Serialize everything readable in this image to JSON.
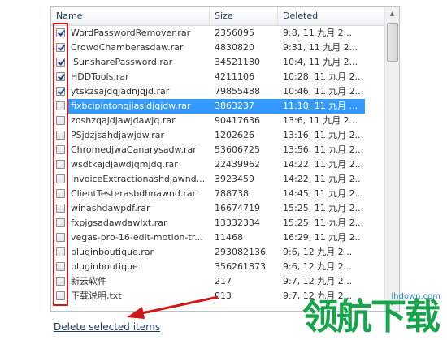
{
  "columns": {
    "name": "Name",
    "size": "Size",
    "deleted": "Deleted"
  },
  "rows": [
    {
      "name": "WordPasswordRemover.rar",
      "size": "2356095",
      "deleted": "9:8, 11 九月 2...",
      "checked": true,
      "selected": false
    },
    {
      "name": "CrowdChamberasdaw.rar",
      "size": "4830820",
      "deleted": "9:31, 11 九月 2...",
      "checked": true,
      "selected": false
    },
    {
      "name": "iSunsharePassword.rar",
      "size": "34521180",
      "deleted": "10:4, 11 九月 2...",
      "checked": true,
      "selected": false
    },
    {
      "name": "HDDTools.rar",
      "size": "4211106",
      "deleted": "10:28, 11 九月 2...",
      "checked": true,
      "selected": false
    },
    {
      "name": "ytskzsajdqjadnjqjd.rar",
      "size": "79855488",
      "deleted": "10:46, 11 九月 2...",
      "checked": true,
      "selected": false
    },
    {
      "name": "fixbcipintongjiasjdjqjdw.rar",
      "size": "3863237",
      "deleted": "11:18, 11 九月 ...",
      "checked": false,
      "selected": true
    },
    {
      "name": "zoshzqajdjawjdawjq.rar",
      "size": "90417636",
      "deleted": "13:6, 11 九月 2...",
      "checked": false,
      "selected": false
    },
    {
      "name": "PSjdzjsahdjawjdw.rar",
      "size": "1202626",
      "deleted": "13:16, 11 九月 2...",
      "checked": false,
      "selected": false
    },
    {
      "name": "ChromedjwaCanarysadw.rar",
      "size": "53606725",
      "deleted": "13:56, 11 九月 2...",
      "checked": false,
      "selected": false
    },
    {
      "name": "wsdtkajdjawdjqmjdq.rar",
      "size": "22439962",
      "deleted": "14:22, 11 九月 2...",
      "checked": false,
      "selected": false
    },
    {
      "name": "InvoiceExtractionashdjawnd...",
      "size": "3923459",
      "deleted": "14:22, 11 九月 2...",
      "checked": false,
      "selected": false
    },
    {
      "name": "ClientTesterasbdhnawnd.rar",
      "size": "788738",
      "deleted": "14:45, 11 九月 2...",
      "checked": false,
      "selected": false
    },
    {
      "name": "winashdawpdf.rar",
      "size": "16674719",
      "deleted": "15:25, 11 九月 2...",
      "checked": false,
      "selected": false
    },
    {
      "name": "fxpjgsadawdawlxt.rar",
      "size": "13332334",
      "deleted": "15:25, 11 九月 2...",
      "checked": false,
      "selected": false
    },
    {
      "name": "vegas-pro-16-edit-motion-tr...",
      "size": "11468",
      "deleted": "16:29, 11 九月 2...",
      "checked": false,
      "selected": false
    },
    {
      "name": "pluginboutique.rar",
      "size": "293082136",
      "deleted": "9:6, 12 九月 2...",
      "checked": false,
      "selected": false
    },
    {
      "name": "pluginboutique",
      "size": "356261873",
      "deleted": "9:6, 12 九月 2...",
      "checked": false,
      "selected": false
    },
    {
      "name": "新云软件",
      "size": "217",
      "deleted": "9:7, 12 九月 2...",
      "checked": false,
      "selected": false
    },
    {
      "name": "下载说明.txt",
      "size": "813",
      "deleted": "9:7, 12 九月 2...",
      "checked": false,
      "selected": false
    }
  ],
  "delete_link": "Delete selected items",
  "watermark": {
    "text": "领航下载",
    "url": "lhdown.com"
  },
  "colors": {
    "selection": "#3399ff",
    "annotation": "#d01818",
    "link": "#1e395b"
  }
}
